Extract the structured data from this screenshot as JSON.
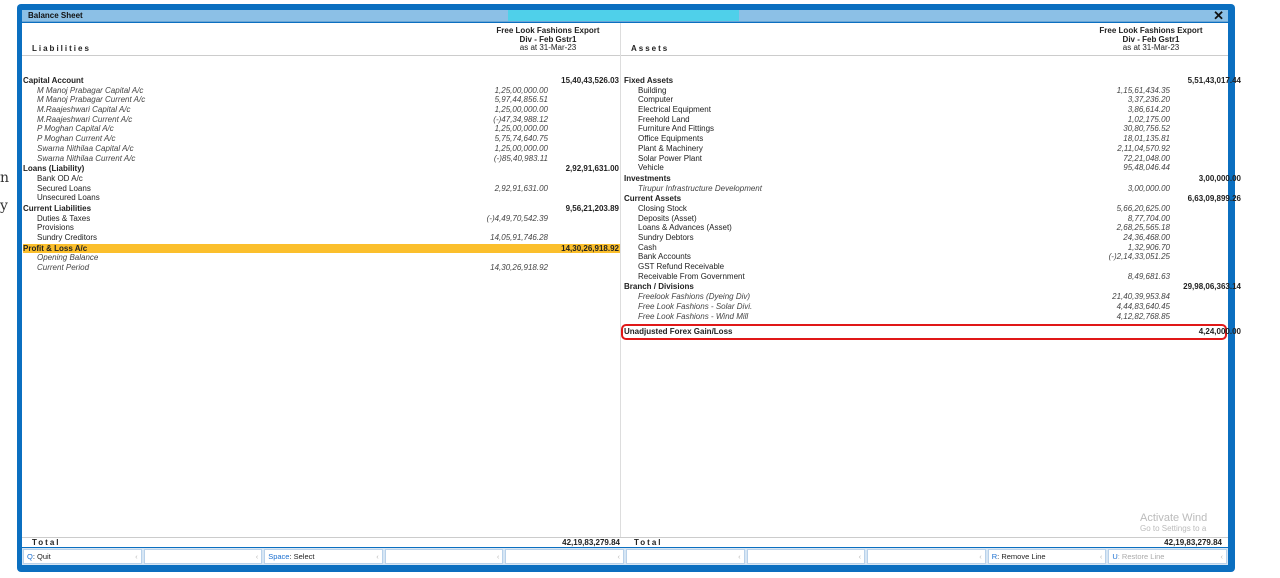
{
  "window": {
    "title": "Balance Sheet",
    "close": "✕"
  },
  "header": {
    "liabilities": "Liabilities",
    "assets": "Assets",
    "company_line1": "Free Look Fashions  Export",
    "company_line2": "Div - Feb Gstr1",
    "date": "as at 31-Mar-23"
  },
  "liabilities": [
    {
      "type": "grp",
      "label": "Capital Account",
      "amount": "15,40,43,526.03"
    },
    {
      "type": "it",
      "label": "M Manoj Prabagar Capital A/c",
      "sub": "1,25,00,000.00"
    },
    {
      "type": "it",
      "label": "M Manoj Prabagar Current A/c",
      "sub": "5,97,44,856.51"
    },
    {
      "type": "it",
      "label": "M.Raajeshwari Capital A/c",
      "sub": "1,25,00,000.00"
    },
    {
      "type": "it",
      "label": "M.Raajeshwari Current A/c",
      "sub": "(-)47,34,988.12"
    },
    {
      "type": "it",
      "label": "P Moghan Capital A/c",
      "sub": "1,25,00,000.00"
    },
    {
      "type": "it",
      "label": "P Moghan Current A/c",
      "sub": "5,75,74,640.75"
    },
    {
      "type": "it",
      "label": "Swarna Nithilaa Capital A/c",
      "sub": "1,25,00,000.00"
    },
    {
      "type": "it",
      "label": "Swarna Nithilaa Current A/c",
      "sub": "(-)85,40,983.11"
    },
    {
      "type": "grp",
      "label": "Loans (Liability)",
      "amount": "2,92,91,631.00"
    },
    {
      "type": "item",
      "label": "Bank OD A/c"
    },
    {
      "type": "item",
      "label": "Secured Loans",
      "sub": "2,92,91,631.00"
    },
    {
      "type": "item",
      "label": "Unsecured Loans"
    },
    {
      "type": "grp",
      "label": "Current Liabilities",
      "amount": "9,56,21,203.89"
    },
    {
      "type": "item",
      "label": "Duties & Taxes",
      "sub": "(-)4,49,70,542.39"
    },
    {
      "type": "item",
      "label": "Provisions"
    },
    {
      "type": "item",
      "label": "Sundry Creditors",
      "sub": "14,05,91,746.28"
    },
    {
      "type": "grp hl",
      "label": "Profit & Loss A/c",
      "amount": "14,30,26,918.92"
    },
    {
      "type": "it",
      "label": "Opening Balance"
    },
    {
      "type": "it",
      "label": "Current Period",
      "sub": "14,30,26,918.92"
    }
  ],
  "assets": [
    {
      "type": "grp",
      "label": "Fixed Assets",
      "amount": "5,51,43,017.44"
    },
    {
      "type": "item",
      "label": "Building",
      "sub": "1,15,61,434.35"
    },
    {
      "type": "item",
      "label": "Computer",
      "sub": "3,37,236.20"
    },
    {
      "type": "item",
      "label": "Electrical Equipment",
      "sub": "3,86,614.20"
    },
    {
      "type": "item",
      "label": "Freehold Land",
      "sub": "1,02,175.00"
    },
    {
      "type": "item",
      "label": "Furniture And Fittings",
      "sub": "30,80,756.52"
    },
    {
      "type": "item",
      "label": "Office Equipments",
      "sub": "18,01,135.81"
    },
    {
      "type": "item",
      "label": "Plant & Machinery",
      "sub": "2,11,04,570.92"
    },
    {
      "type": "item",
      "label": "Solar Power Plant",
      "sub": "72,21,048.00"
    },
    {
      "type": "item",
      "label": "Vehicle",
      "sub": "95,48,046.44"
    },
    {
      "type": "grp",
      "label": "Investments",
      "amount": "3,00,000.00"
    },
    {
      "type": "it",
      "label": "Tirupur Infrastructure Development",
      "sub": "3,00,000.00"
    },
    {
      "type": "grp",
      "label": "Current Assets",
      "amount": "6,63,09,899.26"
    },
    {
      "type": "item",
      "label": "Closing Stock",
      "sub": "5,66,20,625.00"
    },
    {
      "type": "item",
      "label": "Deposits (Asset)",
      "sub": "8,77,704.00"
    },
    {
      "type": "item",
      "label": "Loans & Advances (Asset)",
      "sub": "2,68,25,565.18"
    },
    {
      "type": "item",
      "label": "Sundry Debtors",
      "sub": "24,36,468.00"
    },
    {
      "type": "item",
      "label": "Cash",
      "sub": "1,32,906.70"
    },
    {
      "type": "item",
      "label": "Bank Accounts",
      "sub": "(-)2,14,33,051.25"
    },
    {
      "type": "item",
      "label": "GST Refund Receivable"
    },
    {
      "type": "item",
      "label": "Receivable From Government",
      "sub": "8,49,681.63"
    },
    {
      "type": "grp",
      "label": "Branch / Divisions",
      "amount": "29,98,06,363.14"
    },
    {
      "type": "it",
      "label": "Freelook Fashions (Dyeing Div)",
      "sub": "21,40,39,953.84"
    },
    {
      "type": "it",
      "label": "Free Look Fashions - Solar Divi.",
      "sub": "4,44,83,640.45"
    },
    {
      "type": "it",
      "label": "Free Look Fashions - Wind Mill",
      "sub": "4,12,82,768.85"
    },
    {
      "type": "box",
      "label": "Unadjusted Forex Gain/Loss",
      "amount": "4,24,000.00"
    }
  ],
  "totals": {
    "label": "Total",
    "liabilities": "42,19,83,279.84",
    "assets": "42,19,83,279.84"
  },
  "footer": [
    {
      "key": "Q",
      "label": ": Quit"
    },
    {
      "key": "",
      "label": ""
    },
    {
      "key": "Space",
      "label": ": Select"
    },
    {
      "key": "",
      "label": ""
    },
    {
      "key": "",
      "label": ""
    },
    {
      "key": "",
      "label": ""
    },
    {
      "key": "",
      "label": ""
    },
    {
      "key": "",
      "label": ""
    },
    {
      "key": "R",
      "label": ": Remove Line"
    },
    {
      "key": "U",
      "label": ": Restore Line",
      "disabled": true
    }
  ],
  "watermark": {
    "line1": "Activate Wind",
    "line2": "Go to Settings to a"
  }
}
